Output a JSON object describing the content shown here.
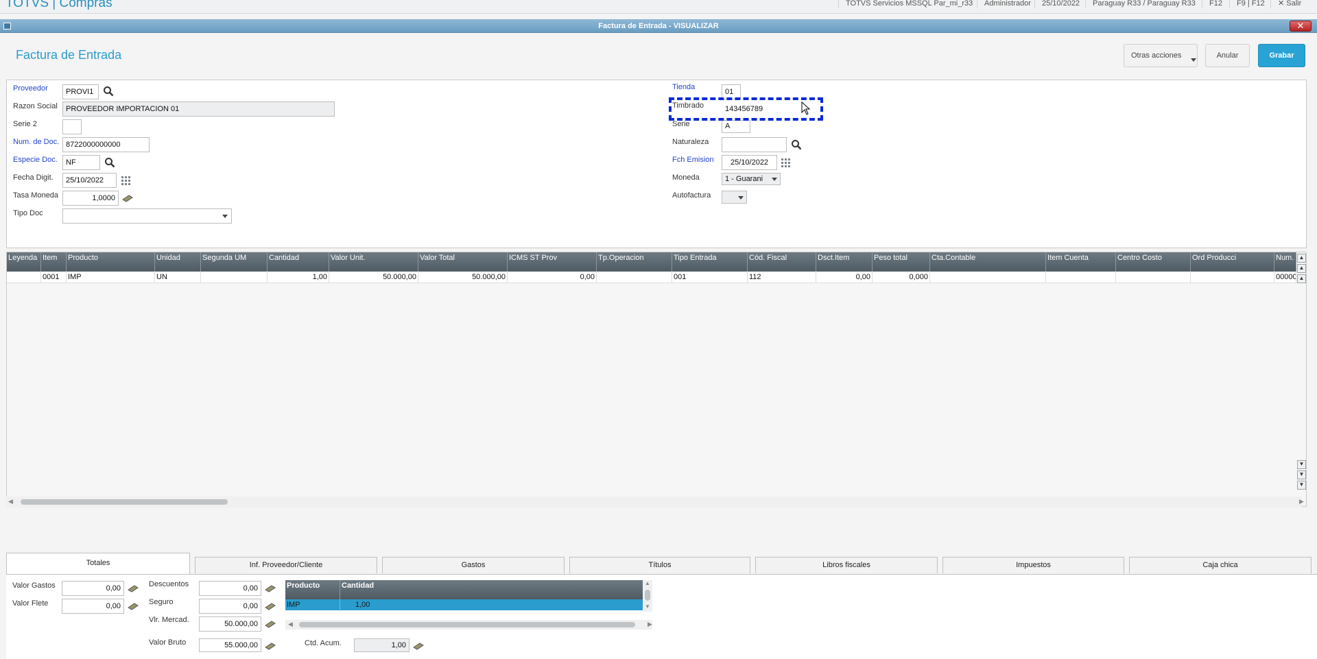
{
  "topbar": {
    "app_title": "TOTVS | Compras",
    "server": "TOTVS Servicios MSSQL Par_mi_r33",
    "user": "Administrador",
    "date": "25/10/2022",
    "branch": "Paraguay R33 / Paraguay R33",
    "shortcut1": "F12",
    "shortcut2": "F9 | F12",
    "exit_label": "Salir"
  },
  "window": {
    "title": "Factura de Entrada - VISUALIZAR",
    "close_glyph": "✕"
  },
  "header": {
    "title": "Factura de Entrada",
    "otras_acciones": "Otras acciones",
    "anular": "Anular",
    "grabar": "Grabar"
  },
  "form": {
    "proveedor": {
      "label": "Proveedor",
      "value": "PROVI1"
    },
    "razon_social": {
      "label": "Razon Social",
      "value": "PROVEEDOR IMPORTACION 01"
    },
    "serie2": {
      "label": "Serie 2",
      "value": ""
    },
    "num_doc": {
      "label": "Num. de Doc.",
      "value": "8722000000000"
    },
    "especie_doc": {
      "label": "Especie Doc.",
      "value": "NF"
    },
    "fecha_digit": {
      "label": "Fecha Digit.",
      "value": "25/10/2022"
    },
    "tasa_moneda": {
      "label": "Tasa Moneda",
      "value": "1,0000"
    },
    "tipo_doc": {
      "label": "Tipo Doc",
      "value": ""
    },
    "tienda": {
      "label": "Tienda",
      "value": "01"
    },
    "timbrado": {
      "label": "Timbrado",
      "value": "143456789"
    },
    "serie": {
      "label": "Serie",
      "value": "A"
    },
    "naturaleza": {
      "label": "Naturaleza",
      "value": ""
    },
    "fch_emision": {
      "label": "Fch Emision",
      "value": "25/10/2022"
    },
    "moneda": {
      "label": "Moneda",
      "value": "1 - Guarani"
    },
    "autofactura": {
      "label": "Autofactura",
      "value": ""
    }
  },
  "grid": {
    "columns": [
      "Leyenda",
      "Item",
      "Producto",
      "Unidad",
      "Segunda UM",
      "Cantidad",
      "Valor Unit.",
      "Valor Total",
      "ICMS ST Prov",
      "Tp.Operacion",
      "Tipo Entrada",
      "Cód. Fiscal",
      "Dsct.Item",
      "Peso total",
      "Cta.Contable",
      "Item Cuenta",
      "Centro Costo",
      "Ord Producci",
      "Num."
    ],
    "rows": [
      [
        "",
        "0001",
        "IMP",
        "UN",
        "",
        "1,00",
        "50.000,00",
        "50.000,00",
        "0,00",
        "",
        "001",
        "112",
        "0,00",
        "0,000",
        "",
        "",
        "",
        "",
        "00000"
      ]
    ]
  },
  "tabs": [
    "Totales",
    "Inf. Proveedor/Cliente",
    "Gastos",
    "Títulos",
    "Libros fiscales",
    "Impuestos",
    "Caja chica"
  ],
  "totales": {
    "valor_gastos": {
      "label": "Valor Gastos",
      "value": "0,00"
    },
    "valor_flete": {
      "label": "Valor Flete",
      "value": "0,00"
    },
    "descuentos": {
      "label": "Descuentos",
      "value": "0,00"
    },
    "seguro": {
      "label": "Seguro",
      "value": "0,00"
    },
    "vlr_mercad": {
      "label": "Vlr. Mercad.",
      "value": "50.000,00"
    },
    "valor_bruto": {
      "label": "Valor Bruto",
      "value": "55.000,00"
    },
    "ctd_acum": {
      "label": "Ctd. Acum.",
      "value": "1,00"
    },
    "subgrid": {
      "columns": [
        "Producto",
        "Cantidad"
      ],
      "row": [
        "IMP",
        "1,00"
      ]
    }
  }
}
